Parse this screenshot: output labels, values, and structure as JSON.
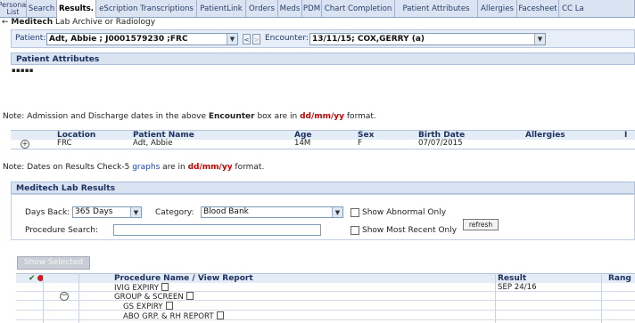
{
  "tabs": [
    {
      "label": "Personal List",
      "active": false
    },
    {
      "label": "Search",
      "active": false
    },
    {
      "label": "Results.",
      "active": true
    },
    {
      "label": "eScription Transcriptions",
      "active": false
    },
    {
      "label": "PatientLink",
      "active": false
    },
    {
      "label": "Orders",
      "active": false
    },
    {
      "label": "Meds",
      "active": false
    },
    {
      "label": "PDM",
      "active": false
    },
    {
      "label": "Chart Completion",
      "active": false
    },
    {
      "label": "Patient Attributes",
      "active": false
    },
    {
      "label": "Allergies",
      "active": false
    },
    {
      "label": "Facesheet",
      "active": false
    },
    {
      "label": "CC La",
      "active": false
    }
  ],
  "sublinks": {
    "prefix": "←",
    "meditech": "Meditech",
    "archive": "Lab Archive or Radiology"
  },
  "patient_bar": {
    "patient_label": "Patient:",
    "patient_value": "Adt, Abbie ; J0001579230 ;FRC",
    "encounter_label": "Encounter:",
    "encounter_value": "13/11/15; COX,GERRY (a)"
  },
  "attributes": {
    "title": "Patient Attributes",
    "dots": "▪▪▪▪▪"
  },
  "note1": {
    "before": "Note:  Admission and Discharge dates in the above ",
    "bold": "Encounter",
    "middle": " box are in ",
    "format": "dd/mm/yy",
    "after": " format."
  },
  "patient_grid": {
    "headers": {
      "location": "Location",
      "name": "Patient Name",
      "age": "Age",
      "sex": "Sex",
      "birth": "Birth Date",
      "allergies": "Allergies",
      "cut": "I"
    },
    "row": {
      "location": "FRC",
      "name": "Adt, Abbie",
      "age": "14M",
      "sex": "F",
      "birth": "07/07/2015"
    }
  },
  "note2": {
    "before": "Note:  Dates on Results Check-5 ",
    "link": "graphs",
    "middle": " are in ",
    "format": "dd/mm/yy",
    "after": " format."
  },
  "lab": {
    "title": "Meditech Lab Results",
    "days_label": "Days Back:",
    "days_value": "365 Days",
    "category_label": "Category:",
    "category_value": "Blood Bank",
    "abnormal_label": "Show Abnormal Only",
    "recent_label": "Show Most Recent Only",
    "refresh_label": "refresh",
    "proc_search_label": "Procedure Search:",
    "proc_search_value": ""
  },
  "show_selected": "Show Selected",
  "results": {
    "headers": {
      "check": "✔",
      "procedure": "Procedure Name / View Report",
      "result": "Result",
      "range": "Rang"
    },
    "rows": [
      {
        "procedure": "IVIG EXPIRY",
        "result": "SEP 24/16"
      },
      {
        "procedure": "GROUP & SCREEN",
        "result": ""
      },
      {
        "procedure": "GS EXPIRY",
        "result": ""
      },
      {
        "procedure": "ABO GRP. & RH REPORT",
        "result": ""
      }
    ]
  },
  "colors": {
    "tab_bg": "#d9e3f1",
    "section_bg": "#d8e2f0",
    "red": "#cc0000",
    "link": "#1a44b8"
  }
}
